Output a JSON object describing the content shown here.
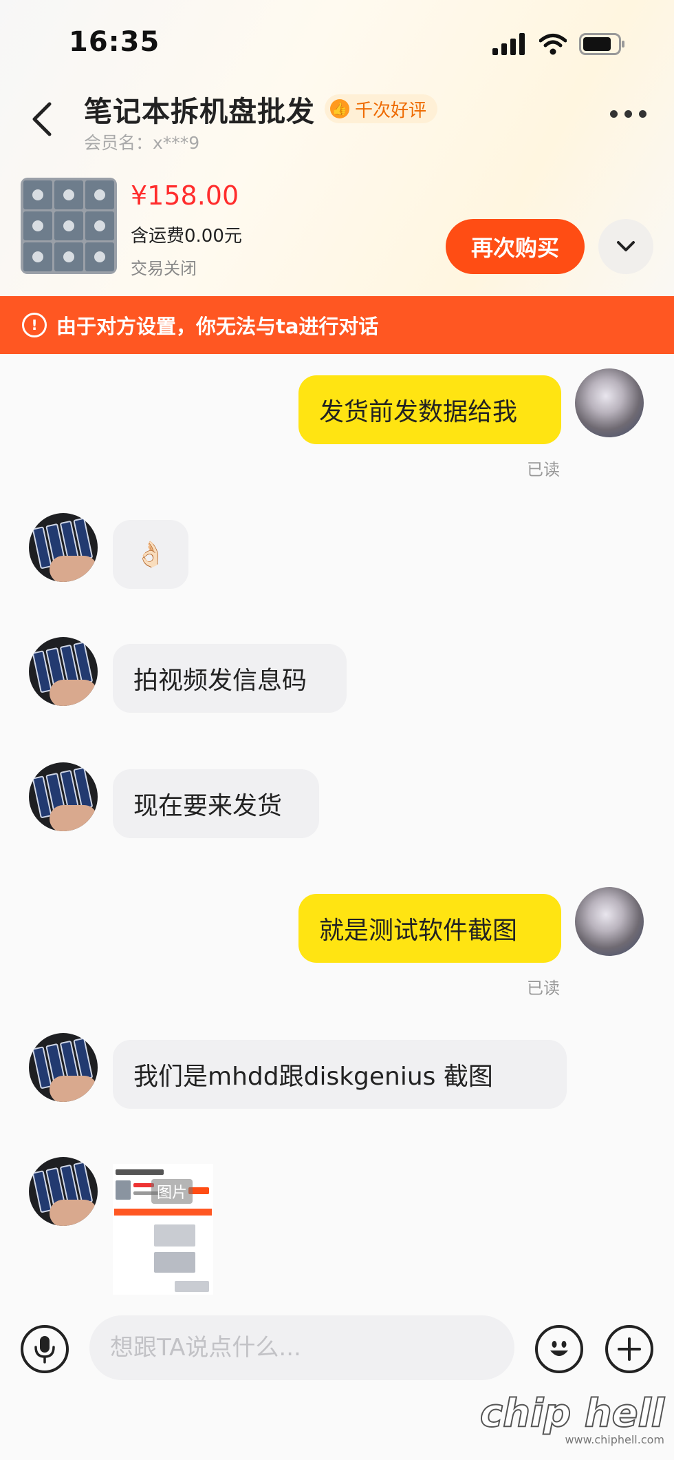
{
  "status_bar": {
    "time": "16:35",
    "icons": [
      "signal-icon",
      "wifi-icon",
      "battery-icon"
    ]
  },
  "header": {
    "title": "笔记本拆机盘批发",
    "badge": "千次好评",
    "member": "会员名：x***9"
  },
  "product": {
    "price": "¥158.00",
    "shipping": "含运费0.00元",
    "status": "交易关闭",
    "rebuy_label": "再次购买"
  },
  "notice": {
    "text": "由于对方设置，你无法与ta进行对话"
  },
  "messages": [
    {
      "from": "me",
      "text": "发货前发数据给我",
      "read": "已读"
    },
    {
      "from": "them",
      "text": "👌🏻"
    },
    {
      "from": "them",
      "text": "拍视频发信息码"
    },
    {
      "from": "them",
      "text": "现在要来发货"
    },
    {
      "from": "me",
      "text": "就是测试软件截图",
      "read": "已读"
    },
    {
      "from": "them",
      "text": "我们是mhdd跟diskgenius   截图"
    },
    {
      "from": "them",
      "type": "image",
      "label": "图片"
    }
  ],
  "input": {
    "placeholder": "想跟TA说点什么..."
  },
  "watermark": {
    "logo": "chip hell",
    "url": "www.chiphell.com"
  },
  "colors": {
    "accent": "#ff4d14",
    "notice_bg": "#ff5722",
    "my_bubble": "#ffe412",
    "their_bubble": "#f0f0f2",
    "price": "#ff2d2d"
  }
}
